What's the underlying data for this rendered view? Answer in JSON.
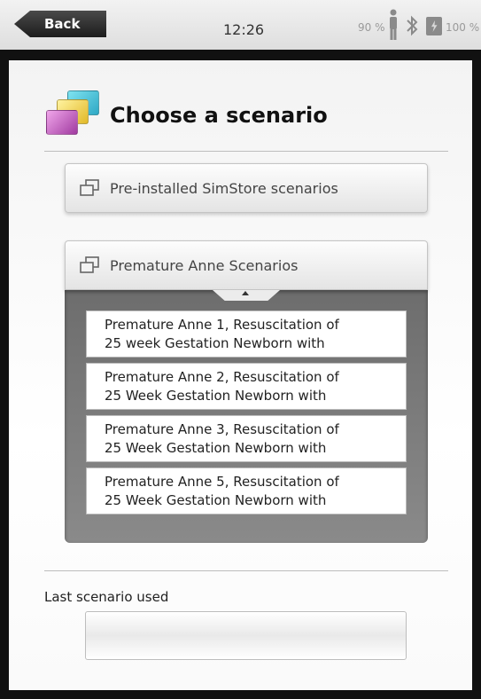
{
  "status_bar": {
    "back_label": "Back",
    "time": "12:26",
    "battery_left": "90 %",
    "battery_right": "100 %",
    "icons": [
      "person-icon",
      "bluetooth-icon",
      "battery-icon"
    ]
  },
  "header": {
    "title": "Choose a scenario",
    "icon": "scenario-tiles-icon"
  },
  "categories": [
    {
      "label": "Pre-installed SimStore scenarios",
      "icon": "windows-icon",
      "expanded": false
    },
    {
      "label": "Premature Anne Scenarios",
      "icon": "windows-icon",
      "expanded": true
    }
  ],
  "scenarios": [
    {
      "line1": "Premature Anne 1, Resuscitation of",
      "line2": "25 week Gestation Newborn with"
    },
    {
      "line1": "Premature Anne 2, Resuscitation of",
      "line2": "25 Week Gestation Newborn with"
    },
    {
      "line1": "Premature Anne 3, Resuscitation of",
      "line2": "25 Week Gestation Newborn with"
    },
    {
      "line1": "Premature Anne 5, Resuscitation of",
      "line2": "25 Week Gestation Newborn with"
    }
  ],
  "last_used": {
    "label": "Last scenario used",
    "value": ""
  }
}
